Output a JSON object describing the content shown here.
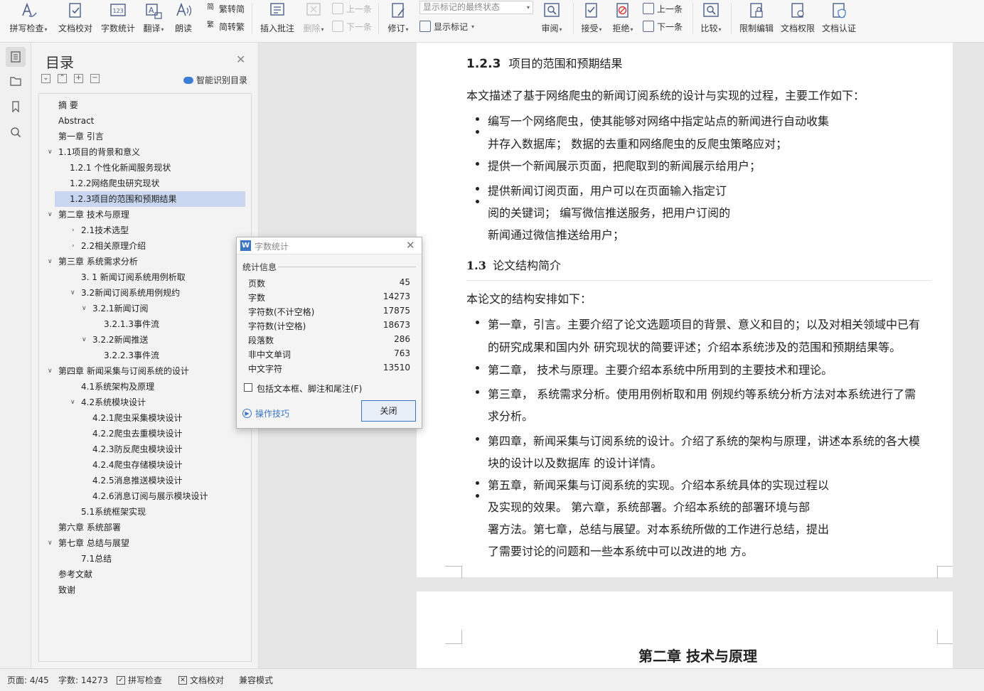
{
  "ribbon": {
    "spell_check": "拼写检查",
    "doc_proof": "文档校对",
    "word_count": "字数统计",
    "translate": "翻译",
    "read_aloud": "朗读",
    "to_traditional": "繁转简",
    "to_simplified": "简转繁",
    "insert_comment": "插入批注",
    "delete": "删除",
    "prev_comment": "上一条",
    "next_comment": "下一条",
    "track_changes": "修订",
    "markup_state": "显示标记的最终状态",
    "show_markup": "显示标记",
    "review": "审阅",
    "accept": "接受",
    "reject": "拒绝",
    "prev_change": "上一条",
    "next_change": "下一条",
    "compare": "比较",
    "restrict_edit": "限制编辑",
    "doc_rights": "文档权限",
    "doc_cert": "文档认证"
  },
  "toc": {
    "title": "目录",
    "smart_label": "智能识别目录",
    "items": [
      {
        "text": "摘  要"
      },
      {
        "text": "Abstract"
      },
      {
        "text": "第一章 引言"
      },
      {
        "text": "1.1项目的背景和意义"
      },
      {
        "text": "1.2.1 个性化新闻服务现状"
      },
      {
        "text": "1.2.2网络爬虫研究现状"
      },
      {
        "text": "1.2.3项目的范围和预期结果"
      },
      {
        "text": "第二章 技术与原理"
      },
      {
        "text": "2.1技术选型"
      },
      {
        "text": "2.2相关原理介绍"
      },
      {
        "text": "第三章 系统需求分析"
      },
      {
        "text": "3. 1 新闻订阅系统用例析取"
      },
      {
        "text": "3.2新闻订阅系统用例规约"
      },
      {
        "text": "3.2.1新闻订阅"
      },
      {
        "text": "3.2.1.3事件流"
      },
      {
        "text": "3.2.2新闻推送"
      },
      {
        "text": "3.2.2.3事件流"
      },
      {
        "text": "第四章 新闻采集与订阅系统的设计"
      },
      {
        "text": "4.1系统架构及原理"
      },
      {
        "text": "4.2系统模块设计"
      },
      {
        "text": "4.2.1爬虫采集模块设计"
      },
      {
        "text": "4.2.2爬虫去重模块设计"
      },
      {
        "text": "4.2.3防反爬虫模块设计"
      },
      {
        "text": "4.2.4爬虫存储模块设计"
      },
      {
        "text": "4.2.5消息推送模块设计"
      },
      {
        "text": "4.2.6消息订阅与展示模块设计"
      },
      {
        "text": "5.1系统框架实现"
      },
      {
        "text": "第六章 系统部署"
      },
      {
        "text": "第七章 总结与展望"
      },
      {
        "text": "7.1总结"
      },
      {
        "text": "参考文献"
      },
      {
        "text": "致谢"
      }
    ]
  },
  "document": {
    "heading_num": "1.2.3",
    "heading_text": "项目的范围和预期结果",
    "intro": "本文描述了基于网络爬虫的新闻订阅系统的设计与实现的过程，主要工作如下：",
    "l1a": "编写一个网络爬虫，使其能够对网络中指定站点的新闻进行自动收集",
    "l1b": "并存入数据库；  数据的去重和网络爬虫的反爬虫策略应对；",
    "l2": "提供一个新闻展示页面，把爬取到的新闻展示给用户；",
    "l3a": "提供新闻订阅页面，用户可以在页面输入指定订",
    "l3b": "阅的关键词；  编写微信推送服务，把用户订阅的",
    "l3c": "新闻通过微信推送给用户；",
    "sec_num": "1.3",
    "sec_text": "论文结构简介",
    "sec_intro": "本论文的结构安排如下：",
    "c1a": "第一章，引言。主要介绍了论文选题项目的背景、意义和目的；以及对相关领域中已有",
    "c1b": "的研究成果和国内外 研究现状的简要评述；介绍本系统涉及的范围和预期结果等。",
    "c2": "第二章，  技术与原理。主要介绍本系统中所用到的主要技术和理论。",
    "c3a": "第三章，  系统需求分析。使用用例析取和用 例规约等系统分析方法对本系统进行了需",
    "c3b": "求分析。",
    "c4a": "第四章，新闻采集与订阅系统的设计。介绍了系统的架构与原理，讲述本系统的各大模",
    "c4b": "块的设计以及数据库 的设计详情。",
    "c5a": "第五章，新闻采集与订阅系统的实现。介绍本系统具体的实现过程以",
    "c5b": "及实现的效果。  第六章，系统部署。介绍本系统的部署环境与部",
    "c5c": "署方法。第七章，总结与展望。对本系统所做的工作进行总结，提出",
    "c5d": "了需要讨论的问题和一些本系统中可以改进的地 方。",
    "page2_heading": "第二章  技术与原理"
  },
  "dialog": {
    "title": "字数统计",
    "section": "统计信息",
    "stats": [
      {
        "label": "页数",
        "value": "45"
      },
      {
        "label": "字数",
        "value": "14273"
      },
      {
        "label": "字符数(不计空格)",
        "value": "17875"
      },
      {
        "label": "字符数(计空格)",
        "value": "18673"
      },
      {
        "label": "段落数",
        "value": "286"
      },
      {
        "label": "非中文单词",
        "value": "763"
      },
      {
        "label": "中文字符",
        "value": "13510"
      }
    ],
    "checkbox_label": "包括文本框、脚注和尾注(F)",
    "checkbox_checked": false,
    "tips": "操作技巧",
    "close": "关闭"
  },
  "status": {
    "page": "页面: 4/45",
    "words": "字数: 14273",
    "spell": "拼写检查",
    "proof": "文档校对",
    "compat": "兼容模式"
  },
  "colors": {
    "accent": "#3a75c4",
    "toc_selected": "#c8d7ef",
    "canvas": "#e6e6e6"
  }
}
